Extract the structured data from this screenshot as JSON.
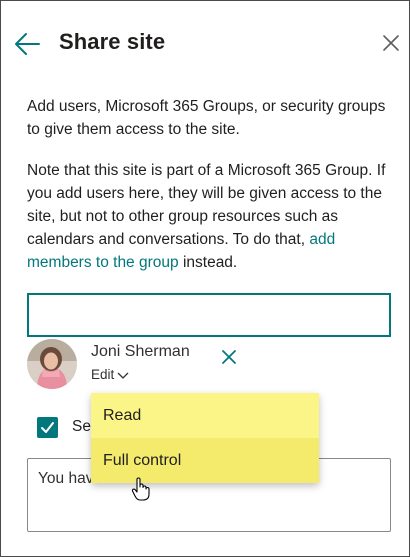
{
  "panel": {
    "title": "Share site",
    "description": "Add users, Microsoft 365 Groups, or security groups to give them access to the site.",
    "note_text": "Note that this site is part of a Microsoft 365 Group. If you add users here, they will be given access to the site, but not to other group resources such as calendars and conversations. To do that, ",
    "note_link": "add members to the group",
    "note_suffix": " instead."
  },
  "people_picker": {
    "value": ""
  },
  "person": {
    "name": "Joni Sherman",
    "permission": "Edit"
  },
  "permission_options": [
    "Read",
    "Full control"
  ],
  "send_email": {
    "label": "Se",
    "checked": true
  },
  "message": {
    "value": "You have been added to this site."
  },
  "colors": {
    "accent": "#03787c",
    "highlight_read": "#fbf486",
    "highlight_full": "#f4eb6d"
  }
}
